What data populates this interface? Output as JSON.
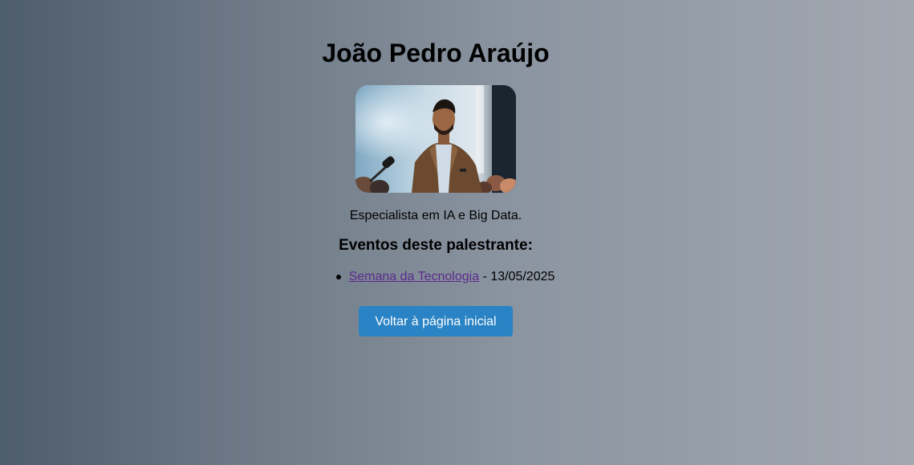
{
  "speaker": {
    "name": "João Pedro Araújo",
    "bio": "Especialista em IA e Big Data.",
    "photo_alt": "João Pedro Araújo"
  },
  "events": {
    "heading": "Eventos deste palestrante:",
    "items": [
      {
        "title": "Semana da Tecnologia",
        "separator": " - ",
        "date": "13/05/2025"
      }
    ]
  },
  "actions": {
    "back_label": "Voltar à página inicial"
  },
  "colors": {
    "button_bg": "#2a83c4",
    "link": "#5a2a8c"
  }
}
